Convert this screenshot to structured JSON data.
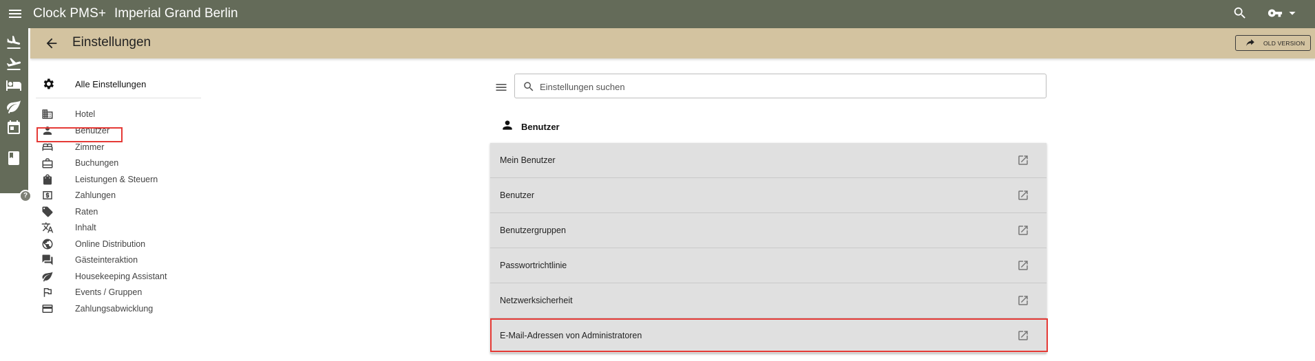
{
  "app": {
    "name": "Clock PMS+",
    "hotel": "Imperial Grand Berlin"
  },
  "header": {
    "title": "Einstellungen",
    "old_version_label": "OLD VERSION"
  },
  "sidenav": {
    "all_settings": "Alle Einstellungen",
    "items": [
      {
        "label": "Hotel",
        "icon": "building-icon"
      },
      {
        "label": "Benutzer",
        "icon": "person-icon"
      },
      {
        "label": "Zimmer",
        "icon": "bed-icon"
      },
      {
        "label": "Buchungen",
        "icon": "briefcase-icon"
      },
      {
        "label": "Leistungen & Steuern",
        "icon": "shopping-bag-icon"
      },
      {
        "label": "Zahlungen",
        "icon": "dollar-icon"
      },
      {
        "label": "Raten",
        "icon": "tag-icon"
      },
      {
        "label": "Inhalt",
        "icon": "translate-icon"
      },
      {
        "label": "Online Distribution",
        "icon": "globe-icon"
      },
      {
        "label": "Gästeinteraktion",
        "icon": "chat-icon"
      },
      {
        "label": "Housekeeping Assistant",
        "icon": "leaf-icon"
      },
      {
        "label": "Events / Gruppen",
        "icon": "flag-icon"
      },
      {
        "label": "Zahlungsabwicklung",
        "icon": "credit-card-icon"
      }
    ],
    "selected": "Benutzer"
  },
  "search": {
    "placeholder": "Einstellungen suchen",
    "value": ""
  },
  "section": {
    "title": "Benutzer",
    "rows": [
      {
        "label": "Mein Benutzer"
      },
      {
        "label": "Benutzer"
      },
      {
        "label": "Benutzergruppen"
      },
      {
        "label": "Passwortrichtlinie"
      },
      {
        "label": "Netzwerksicherheit"
      },
      {
        "label": "E-Mail-Adressen von Administratoren"
      }
    ],
    "highlighted": "Passwortrichtlinie"
  },
  "rail": {
    "icons": [
      "flight-land-icon",
      "flight-takeoff-icon",
      "hotel-bed-icon",
      "leaf-icon",
      "calendar-icon",
      "book-icon"
    ],
    "help": "?"
  },
  "colors": {
    "topbar": "#646b59",
    "header": "#d3c3a0",
    "highlight": "#e53935",
    "card": "#e0e0e0"
  }
}
